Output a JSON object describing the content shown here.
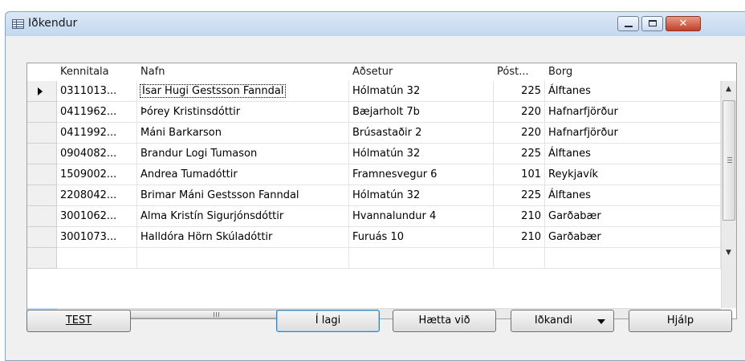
{
  "window": {
    "title": "Iðkendur"
  },
  "table": {
    "columns": [
      "Kennitala",
      "Nafn",
      "Aðsetur",
      "Póst...",
      "Borg"
    ],
    "rows": [
      {
        "kennitala": "0311013...",
        "nafn": "Ísar Hugi Gestsson Fanndal",
        "adsetur": "Hólmatún 32",
        "post": "225",
        "borg": "Álftanes"
      },
      {
        "kennitala": "0411962...",
        "nafn": "Þórey Kristinsdóttir",
        "adsetur": "Bæjarholt 7b",
        "post": "220",
        "borg": "Hafnarfjörður"
      },
      {
        "kennitala": "0411992...",
        "nafn": "Máni Barkarson",
        "adsetur": "Brúsastaðir 2",
        "post": "220",
        "borg": "Hafnarfjörður"
      },
      {
        "kennitala": "0904082...",
        "nafn": "Brandur Logi Tumason",
        "adsetur": "Hólmatún 32",
        "post": "225",
        "borg": "Álftanes"
      },
      {
        "kennitala": "1509002...",
        "nafn": "Andrea Tumadóttir",
        "adsetur": "Framnesvegur 6",
        "post": "101",
        "borg": "Reykjavík"
      },
      {
        "kennitala": "2208042...",
        "nafn": "Brimar Máni Gestsson Fanndal",
        "adsetur": "Hólmatún 32",
        "post": "225",
        "borg": "Álftanes"
      },
      {
        "kennitala": "3001062...",
        "nafn": "Alma Kristín Sigurjónsdóttir",
        "adsetur": "Hvannalundur 4",
        "post": "210",
        "borg": "Garðabær"
      },
      {
        "kennitala": "3001073...",
        "nafn": "Halldóra Hörn Skúladóttir",
        "adsetur": "Furuás 10",
        "post": "210",
        "borg": "Garðabær"
      }
    ]
  },
  "buttons": {
    "test": "TEST",
    "ok": "Í lagi",
    "cancel": "Hætta við",
    "member": "Iðkandi",
    "help": "Hjálp"
  },
  "scrollbar_glyphs": {
    "up": "▲",
    "down": "▼",
    "left": "◀",
    "right": "▶",
    "grip": "III"
  }
}
